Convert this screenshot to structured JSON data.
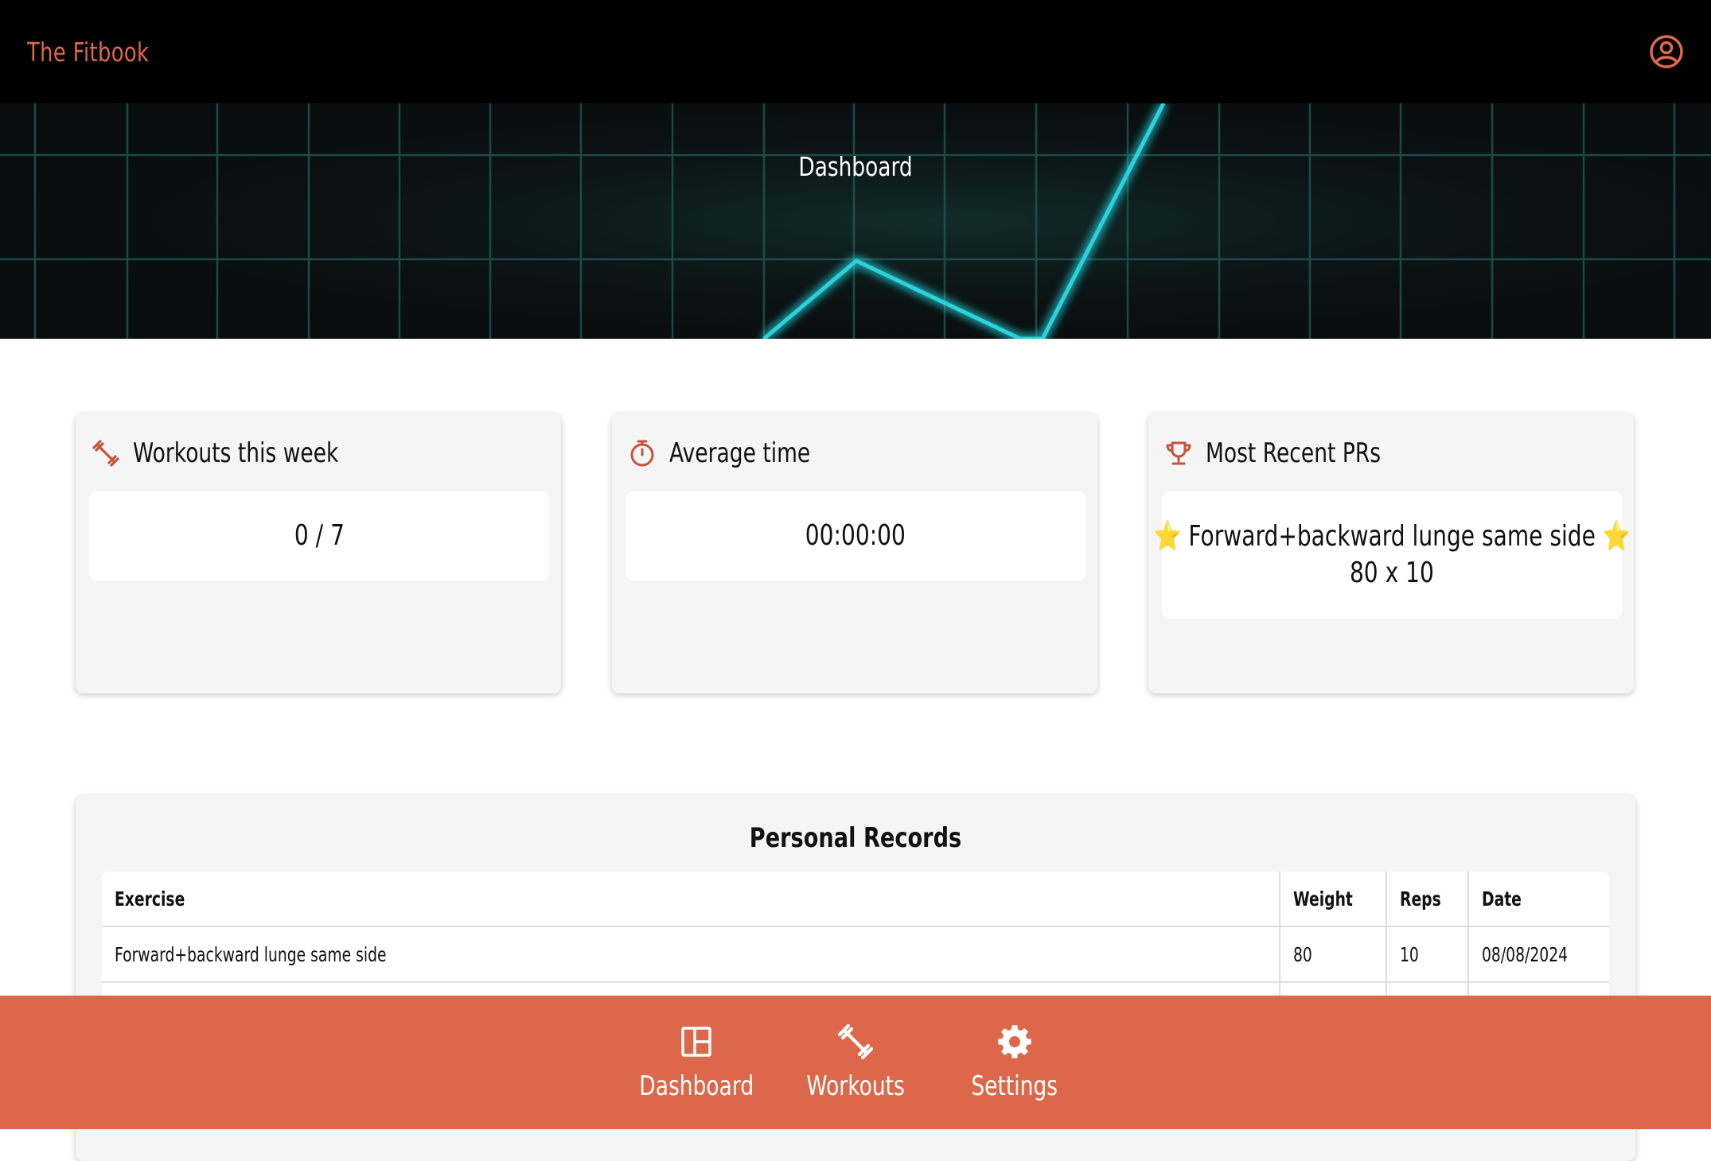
{
  "app": {
    "name": "The Fitbook",
    "account_icon": "account-circle-icon"
  },
  "hero": {
    "title": "Dashboard"
  },
  "cards": [
    {
      "icon": "dumbbell-icon",
      "title": "Workouts this week",
      "value": "0 / 7"
    },
    {
      "icon": "stopwatch-icon",
      "title": "Average time",
      "value": "00:00:00"
    },
    {
      "icon": "trophy-icon",
      "title": "Most Recent PRs",
      "value": "⭐ Forward+backward lunge same side ⭐",
      "detail": "80 x 10"
    }
  ],
  "personal_records": {
    "title": "Personal Records",
    "columns": [
      "Exercise",
      "Weight",
      "Reps",
      "Date"
    ],
    "rows": [
      [
        "Forward+backward lunge same side",
        "80",
        "10",
        "08/08/2024"
      ]
    ]
  },
  "bottom_nav": [
    {
      "icon": "dashboard-icon",
      "label": "Dashboard"
    },
    {
      "icon": "dumbbell-icon",
      "label": "Workouts"
    },
    {
      "icon": "gear-icon",
      "label": "Settings"
    }
  ],
  "colors": {
    "accent": "#dd674b",
    "header": "#000000",
    "card": "#f5f5f5",
    "neon": "#2ad3dc"
  }
}
